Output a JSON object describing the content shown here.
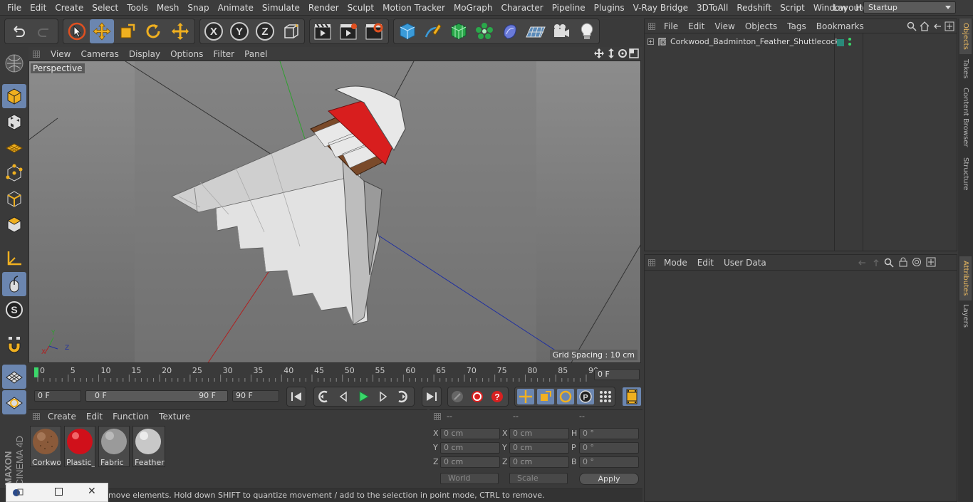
{
  "menu": [
    "File",
    "Edit",
    "Create",
    "Select",
    "Tools",
    "Mesh",
    "Snap",
    "Animate",
    "Simulate",
    "Render",
    "Sculpt",
    "Motion Tracker",
    "MoGraph",
    "Character",
    "Pipeline",
    "Plugins",
    "V-Ray Bridge",
    "3DToAll",
    "Redshift",
    "Script",
    "Window",
    "Help"
  ],
  "layout": {
    "label": "Layout:",
    "value": "Startup"
  },
  "viewport": {
    "menu": [
      "View",
      "Cameras",
      "Display",
      "Options",
      "Filter",
      "Panel"
    ],
    "label": "Perspective",
    "grid_spacing": "Grid Spacing : 10 cm",
    "axes": {
      "x": "X",
      "y": "Y",
      "z": "Z"
    }
  },
  "timeline": {
    "ticks": [
      "0",
      "5",
      "10",
      "15",
      "20",
      "25",
      "30",
      "35",
      "40",
      "45",
      "50",
      "55",
      "60",
      "65",
      "70",
      "75",
      "80",
      "85",
      "90"
    ],
    "current_frame": "0 F"
  },
  "transport": {
    "start": "0 F",
    "range_start": "0 F",
    "range_end": "90 F",
    "end": "90 F"
  },
  "materials": {
    "menu": [
      "Create",
      "Edit",
      "Function",
      "Texture"
    ],
    "items": [
      {
        "name": "Corkwo",
        "color": "#8a5a3a"
      },
      {
        "name": "Plastic_E",
        "color": "#d0101a"
      },
      {
        "name": "Fabric",
        "color": "#9a9a9a"
      },
      {
        "name": "Feathers",
        "color": "#c8c8c8"
      }
    ]
  },
  "coords": {
    "headers": [
      "--",
      "--",
      "--"
    ],
    "rows": [
      {
        "a": "X",
        "av": "0 cm",
        "b": "X",
        "bv": "0 cm",
        "c": "H",
        "cv": "0 °"
      },
      {
        "a": "Y",
        "av": "0 cm",
        "b": "Y",
        "bv": "0 cm",
        "c": "P",
        "cv": "0 °"
      },
      {
        "a": "Z",
        "av": "0 cm",
        "b": "Z",
        "bv": "0 cm",
        "c": "B",
        "cv": "0 °"
      }
    ],
    "space": "World",
    "mode": "Scale",
    "apply": "Apply"
  },
  "status": "move elements. Hold down SHIFT to quantize movement / add to the selection in point mode, CTRL to remove.",
  "objects": {
    "menu": [
      "File",
      "Edit",
      "View",
      "Objects",
      "Tags",
      "Bookmarks"
    ],
    "items": [
      {
        "name": "Corkwood_Badminton_Feather_Shuttlecock",
        "tag_color": "#2a8a7a"
      }
    ]
  },
  "attributes": {
    "menu": [
      "Mode",
      "Edit",
      "User Data"
    ]
  },
  "side_tabs": [
    "Objects",
    "Takes",
    "Content Browser",
    "Structure",
    "Attributes",
    "Layers"
  ],
  "brand": {
    "maxon": "MAXON",
    "product": "CINEMA 4D"
  }
}
